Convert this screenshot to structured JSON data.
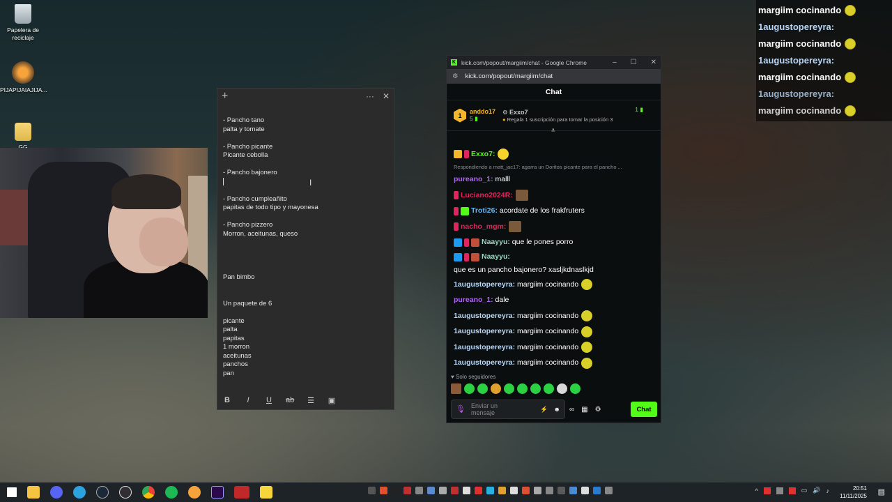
{
  "desktop": {
    "icons": [
      {
        "label": "Papelera de reciclaje",
        "icon": "recycle-bin-icon"
      },
      {
        "label": "PIJAPIJAIAJIJA...",
        "icon": "fl-studio-icon"
      },
      {
        "label": "GG",
        "icon": "folder-icon"
      }
    ]
  },
  "notes": {
    "lines": "- Pancho tano\npalta y tomate\n\n- Pancho picante\nPicante cebolla\n\n- Pancho bajonero\n",
    "lines_after_cursor": "\n\n- Pancho cumpleañito\npapitas de todo tipo y mayonesa\n\n- Pancho pizzero\nMorron, aceitunas, queso\n\n\n\n\nPan bimbo\n\n\nUn paquete de 6\n\npicante\npalta\npapitas\n1 morron\naceitunas\npanchos\npan",
    "toolbar": [
      "B",
      "I",
      "U",
      "ab"
    ]
  },
  "chat_window": {
    "title": "kick.com/popout/margiim/chat - Google Chrome",
    "url": "kick.com/popout/margiim/chat",
    "header": "Chat",
    "pinned": {
      "rank": "1",
      "user": "anddo17",
      "count": "5",
      "gifter": "Exxo7",
      "gift_text": "Regala 1 suscripción para tomar la posición 3",
      "right_count": "1"
    },
    "messages": [
      {
        "user": "Exxo7",
        "color": "#53fc18",
        "text": "",
        "emote": "yes"
      },
      {
        "reply": "Respondiendo a matt_jac17: agarra un Doritos picante para el pancho ..."
      },
      {
        "user": "pureano_1",
        "color": "#b164f5",
        "text": "malll"
      },
      {
        "user": "Luciano2024R",
        "color": "#e0245e",
        "text": "",
        "emote": "sq"
      },
      {
        "user": "Troti26",
        "color": "#5fb7f5",
        "text": "acordate de los frakfruters"
      },
      {
        "user": "nacho_mgm",
        "color": "#e0245e",
        "text": "",
        "emote": "sq"
      },
      {
        "user": "Naayyu",
        "color": "#9ad7c0",
        "text": "que le pones porro"
      },
      {
        "user": "Naayyu",
        "color": "#9ad7c0",
        "text": "que es un pancho bajonero? xasljkdnaslkjd"
      },
      {
        "user": "1augustopereyra",
        "color": "#b9d6f5",
        "text": "margiim cocinando"
      },
      {
        "user": "pureano_1",
        "color": "#b164f5",
        "text": "dale"
      },
      {
        "user": "1augustopereyra",
        "color": "#b9d6f5",
        "text": "margiim cocinando"
      },
      {
        "user": "1augustopereyra",
        "color": "#b9d6f5",
        "text": "margiim cocinando"
      },
      {
        "user": "1augustopereyra",
        "color": "#b9d6f5",
        "text": "margiim cocinando"
      },
      {
        "user": "1augustopereyra",
        "color": "#b9d6f5",
        "text": "margiim cocinando"
      }
    ],
    "followers_only": "Solo seguidores",
    "input_placeholder": "Enviar un mensaje",
    "send_label": "Chat"
  },
  "overlay": {
    "lines": [
      {
        "text": "margiim cocinando",
        "color": "#ffffff",
        "emote": true
      },
      {
        "text": "1augustopereyra:",
        "color": "#b9d6f5",
        "emote": false
      },
      {
        "text": "margiim cocinando",
        "color": "#ffffff",
        "emote": true
      },
      {
        "text": "1augustopereyra:",
        "color": "#b9d6f5",
        "emote": false
      },
      {
        "text": "margiim cocinando",
        "color": "#ffffff",
        "emote": true
      },
      {
        "text": "1augustopereyra:",
        "color": "#b9d6f5",
        "emote": false
      },
      {
        "text": "margiim cocinando",
        "color": "#ffffff",
        "emote": true
      }
    ]
  },
  "taskbar": {
    "time": "20:51",
    "date": "11/11/2025"
  }
}
